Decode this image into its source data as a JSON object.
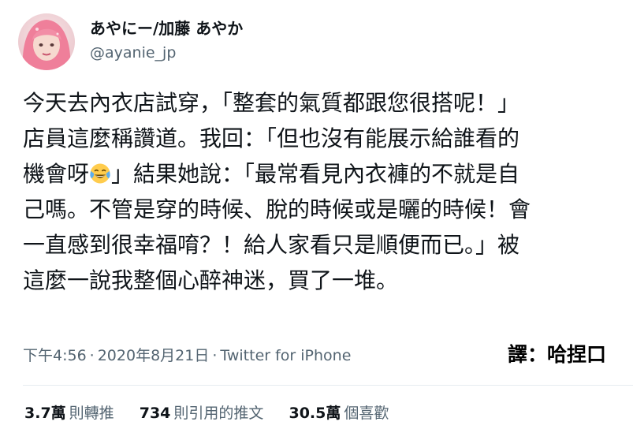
{
  "author": {
    "display_name": "あやにー/加藤 あやか",
    "handle": "@ayanie_jp",
    "avatar": "avatar-photo"
  },
  "tweet": {
    "lines": [
      "今天去內衣店試穿，「整套的氣質都跟您很搭呢！」",
      "店員這麼稱讚道。我回：「但也沒有能展示給誰看的",
      "」結果她說：「最常看見內衣褲的不就是自",
      "己嗎。不管是穿的時候、脫的時候或是曬的時候！會",
      "一直感到很幸福唷？！給人家看只是順便而已。」被",
      "這麼一說我整個心醉神迷，買了一堆。"
    ],
    "line3_prefix": "機會呀",
    "emoji": "face-with-tears-of-joy"
  },
  "meta": {
    "time": "下午4:56",
    "date": "2020年8月21日",
    "separator": "·",
    "source": "Twitter for iPhone"
  },
  "translator": "譯：哈捏口",
  "stats": {
    "retweets_count": "3.7萬",
    "retweets_label": "則轉推",
    "quotes_count": "734",
    "quotes_label": "則引用的推文",
    "likes_count": "30.5萬",
    "likes_label": "個喜歡"
  },
  "colors": {
    "text": "#0f1419",
    "secondary": "#536471",
    "divider": "#e6ecf0"
  }
}
